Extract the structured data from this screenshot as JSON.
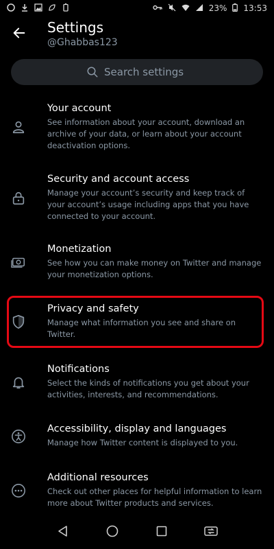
{
  "status_bar": {
    "battery": "23%",
    "time": "13:53"
  },
  "header": {
    "title": "Settings",
    "username": "@Ghabbas123"
  },
  "search": {
    "placeholder": "Search settings"
  },
  "settings_items": [
    {
      "title": "Your account",
      "description": "See information about your account, download an archive of your data, or learn about your account deactivation options."
    },
    {
      "title": "Security and account access",
      "description": "Manage your account’s security and keep track of your account’s usage including apps that you have connected to your account."
    },
    {
      "title": "Monetization",
      "description": "See how you can make money on Twitter and manage your monetization options."
    },
    {
      "title": "Privacy and safety",
      "description": "Manage what information you see and share on Twitter."
    },
    {
      "title": "Notifications",
      "description": "Select the kinds of notifications you get about your activities, interests, and recommendations."
    },
    {
      "title": "Accessibility, display and languages",
      "description": "Manage how Twitter content is displayed to you."
    },
    {
      "title": "Additional resources",
      "description": "Check out other places for helpful information to learn more about Twitter products and services."
    }
  ],
  "icons": {
    "back": "arrow-left-icon",
    "search": "search-icon",
    "account": "person-icon",
    "security": "lock-icon",
    "monetization": "money-icon",
    "privacy": "shield-icon",
    "notifications": "bell-icon",
    "accessibility": "accessibility-icon",
    "resources": "more-icon"
  },
  "colors": {
    "background": "#000000",
    "text_primary": "#ffffff",
    "text_secondary": "#8b98a5",
    "search_bg": "#202327",
    "highlight": "#e50914"
  }
}
